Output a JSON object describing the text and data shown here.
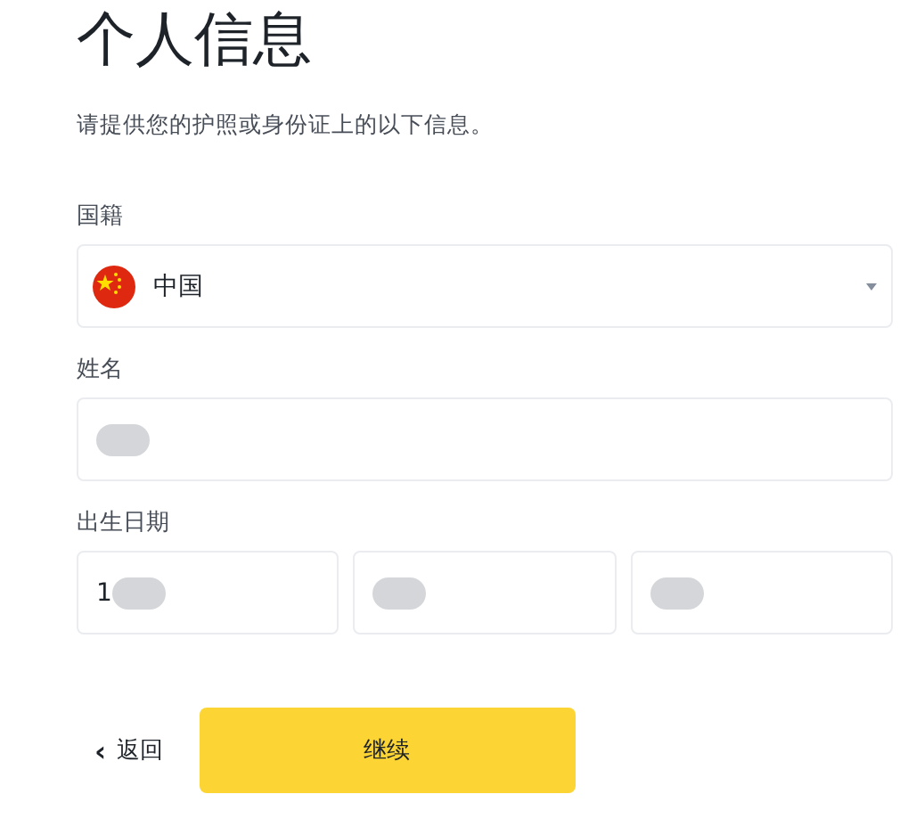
{
  "title": "个人信息",
  "subtitle": "请提供您的护照或身份证上的以下信息。",
  "fields": [
    {
      "kind": "select",
      "label": "国籍",
      "value": "中国"
    },
    {
      "kind": "text",
      "label": "姓名",
      "redacted": true
    },
    {
      "kind": "date",
      "label": "出生日期",
      "parts": [
        {
          "value": "1",
          "redacted": true
        },
        {
          "redacted": true
        },
        {
          "redacted": true
        }
      ]
    }
  ],
  "buttons": {
    "back": {
      "icon": "‹",
      "label": "返回"
    },
    "continue": {
      "label": "继续"
    }
  }
}
